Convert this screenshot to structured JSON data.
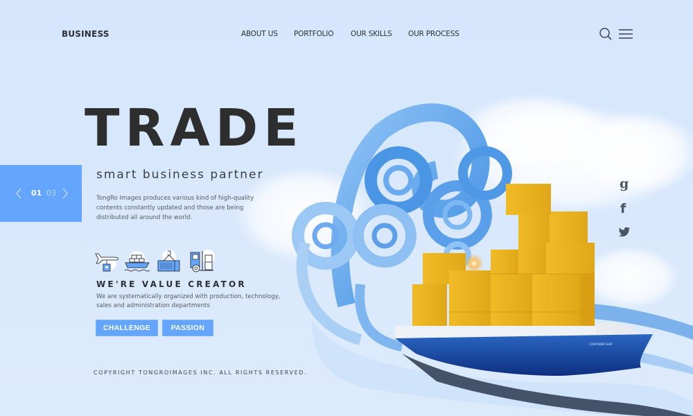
{
  "header": {
    "logo": "BUSINESS",
    "nav": [
      {
        "label": "ABOUT US"
      },
      {
        "label": "PORTFOLIO"
      },
      {
        "label": "OUR SKILLS"
      },
      {
        "label": "OUR PROCESS"
      }
    ],
    "icons": {
      "search": "search-icon",
      "menu": "hamburger-menu-icon"
    }
  },
  "hero": {
    "title": "TRADE",
    "subtitle": "smart business partner",
    "description": "TongRo Images produces various kind of high-quality contents constantly updated and those are being distributed all around the world.",
    "slider": {
      "current": "01",
      "total": "03",
      "prev_icon": "chevron-left-icon",
      "next_icon": "chevron-right-icon"
    }
  },
  "services": [
    {
      "name": "air-freight",
      "icon": "airplane-package-icon"
    },
    {
      "name": "sea-freight",
      "icon": "cargo-ship-icon"
    },
    {
      "name": "container",
      "icon": "container-crane-icon"
    },
    {
      "name": "land-freight",
      "icon": "truck-forklift-icon"
    }
  ],
  "value": {
    "title": "WE'RE VALUE CREATOR",
    "description": "We are systematically organized with production, technology, sales and administration departments",
    "buttons": [
      {
        "label": "CHALLENGE"
      },
      {
        "label": "PASSION"
      }
    ]
  },
  "social": [
    {
      "name": "google",
      "glyph": "g"
    },
    {
      "name": "facebook",
      "glyph": "f"
    },
    {
      "name": "twitter",
      "glyph": "twitter-bird"
    }
  ],
  "illustration": {
    "ship_label": "CONTAINER SHIP",
    "description": "Paper-craft blue wave swirls with a container ship carrying yellow cargo boxes among clouds"
  },
  "footer": {
    "copyright": "COPYRIGHT TONGROIMAGES INC. ALL RIGHTS RESERVED."
  },
  "colors": {
    "background": "#d7e8fd",
    "accent": "#64a6fd",
    "text_dark": "#2e2e2e",
    "cargo": "#e8b020",
    "hull": "#1f4fa8"
  }
}
